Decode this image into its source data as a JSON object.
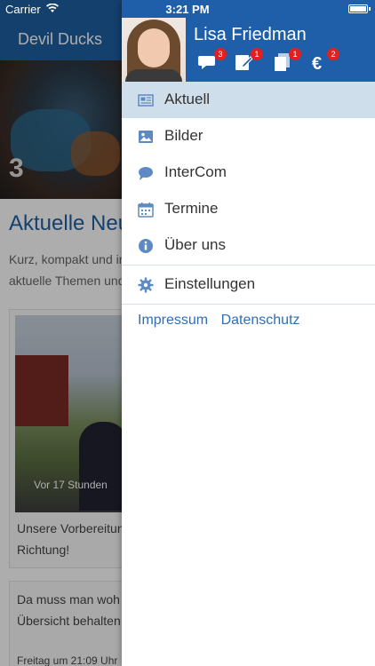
{
  "status": {
    "carrier": "Carrier",
    "time": "3:21 PM"
  },
  "background": {
    "nav_title": "Devil Ducks",
    "hero_number": "3",
    "heading": "Aktuelle Neu",
    "intro_lines": [
      "Kurz, kompakt und in",
      "aktuelle Themen und"
    ],
    "card": {
      "timestamp": "Vor 17 Stunden",
      "caption_lines": [
        "Unsere Vorbereitun",
        "Richtung!"
      ]
    },
    "card2": {
      "caption_lines": [
        "Da muss man woh",
        "Übersicht behalten"
      ],
      "date": "Freitag um 21:09 Uhr"
    }
  },
  "drawer": {
    "user_name": "Lisa Friedman",
    "badges": {
      "chat": "3",
      "edit": "1",
      "documents": "1",
      "euro": "2"
    },
    "menu": [
      {
        "label": "Aktuell",
        "icon": "newspaper-icon",
        "active": true
      },
      {
        "label": "Bilder",
        "icon": "image-icon"
      },
      {
        "label": "InterCom",
        "icon": "chat-bubble-icon"
      },
      {
        "label": "Termine",
        "icon": "calendar-icon"
      },
      {
        "label": "Über uns",
        "icon": "info-icon"
      }
    ],
    "settings_label": "Einstellungen",
    "links": {
      "impressum": "Impressum",
      "datenschutz": "Datenschutz"
    }
  },
  "colors": {
    "brand_blue": "#1f5ea8",
    "active_row": "#cfdeeb",
    "link": "#2f6eb5",
    "badge_red": "#e02121"
  }
}
